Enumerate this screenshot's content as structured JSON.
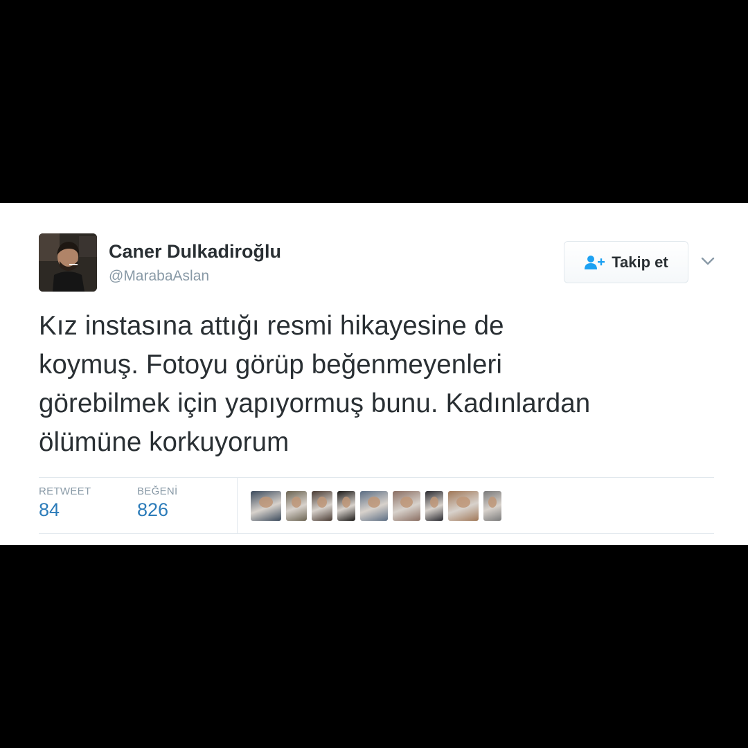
{
  "tweet": {
    "author": {
      "display_name": "Caner Dulkadiroğlu",
      "handle": "@MarabaAslan",
      "avatar_icon": "user-avatar-photo"
    },
    "follow_button": {
      "label": "Takip et",
      "icon": "add-user-icon"
    },
    "more_icon": "chevron-down-icon",
    "text_lines": [
      "Kız instasına attığı resmi hikayesine de",
      "koymuş. Fotoyu görüp beğenmeyenleri",
      "görebilmek için yapıyormuş bunu. Kadınlardan",
      "ölümüne korkuyorum"
    ],
    "stats": {
      "retweet": {
        "label": "RETWEET",
        "value": "84"
      },
      "likes": {
        "label": "BEĞENİ",
        "value": "826"
      }
    },
    "likers": [
      {
        "name": "liker-avatar-1",
        "color": "#3b4a5c"
      },
      {
        "name": "liker-avatar-2",
        "color": "#6b6452"
      },
      {
        "name": "liker-avatar-3",
        "color": "#4a3c34"
      },
      {
        "name": "liker-avatar-4",
        "color": "#1c1a18"
      },
      {
        "name": "liker-avatar-5",
        "color": "#5c6e84"
      },
      {
        "name": "liker-avatar-6",
        "color": "#8a6e62"
      },
      {
        "name": "liker-avatar-7",
        "color": "#2a2a30"
      },
      {
        "name": "liker-avatar-8",
        "color": "#a07858"
      },
      {
        "name": "liker-avatar-9",
        "color": "#7a7a7a"
      }
    ]
  },
  "colors": {
    "frame_background": "#000000",
    "card_background": "#ffffff",
    "text_primary": "#292f33",
    "text_secondary": "#8899a6",
    "stat_value": "#2b7bb9",
    "follow_icon": "#1da1f2",
    "border": "#e1e8ed"
  }
}
